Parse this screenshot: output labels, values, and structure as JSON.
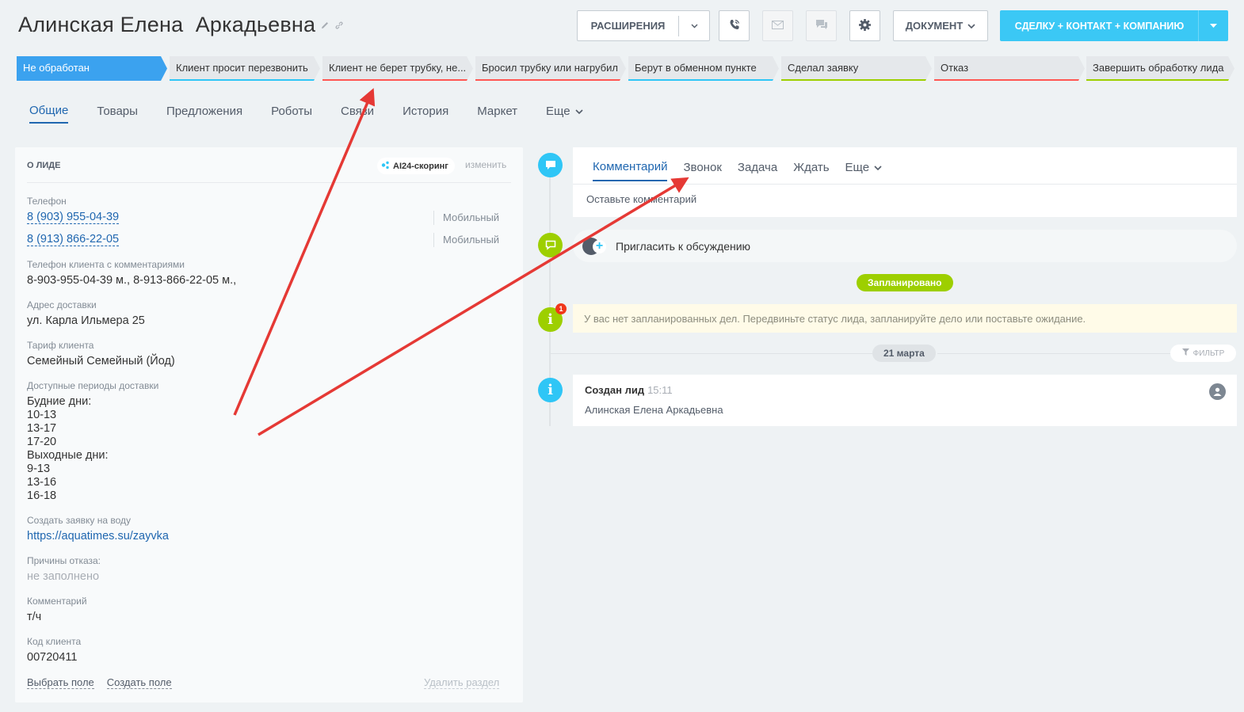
{
  "header": {
    "title": "Алинская Елена  Аркадьевна",
    "extensions_label": "РАСШИРЕНИЯ",
    "document_label": "ДОКУМЕНТ",
    "create_label": "СДЕЛКУ + КОНТАКТ + КОМПАНИЮ"
  },
  "stages": [
    {
      "label": "Не обработан",
      "color": "#3ba2ef",
      "active": true
    },
    {
      "label": "Клиент просит перезвонить",
      "color": "#2fc6f6"
    },
    {
      "label": "Клиент не берет трубку, не...",
      "color": "#ff5752"
    },
    {
      "label": "Бросил трубку или нагрубил",
      "color": "#ff5752"
    },
    {
      "label": "Берут в обменном пункте",
      "color": "#2fc6f6"
    },
    {
      "label": "Сделал заявку",
      "color": "#9dcf00"
    },
    {
      "label": "Отказ",
      "color": "#ff5752"
    },
    {
      "label": "Завершить обработку лида",
      "color": "#9dcf00"
    }
  ],
  "tabs": [
    {
      "label": "Общие",
      "active": true
    },
    {
      "label": "Товары"
    },
    {
      "label": "Предложения"
    },
    {
      "label": "Роботы"
    },
    {
      "label": "Связи"
    },
    {
      "label": "История"
    },
    {
      "label": "Маркет"
    },
    {
      "label": "Еще"
    }
  ],
  "card": {
    "heading": "О ЛИДЕ",
    "ai_label": "AI24-скоринг",
    "change_label": "изменить",
    "phone_label": "Телефон",
    "phones": [
      {
        "number": "8 (903) 955-04-39",
        "type": "Мобильный"
      },
      {
        "number": "8 (913) 866-22-05",
        "type": "Мобильный"
      }
    ],
    "phone_comments_label": "Телефон клиента с комментариями",
    "phone_comments_value": "8-903-955-04-39 м., 8-913-866-22-05 м.,",
    "address_label": "Адрес доставки",
    "address_value": "ул. Карла Ильмера 25",
    "tariff_label": "Тариф клиента",
    "tariff_value": "Семейный Семейный (Йод)",
    "periods_label": "Доступные периоды доставки",
    "periods_lines": [
      "Будние дни:",
      "10-13",
      "13-17",
      "17-20",
      "Выходные дни:",
      "9-13",
      "13-16",
      "16-18"
    ],
    "order_label": "Создать заявку на воду",
    "order_url": "https://aquatimes.su/zayvka",
    "refuse_label": "Причины отказа:",
    "refuse_value": "не заполнено",
    "comment_label": "Комментарий",
    "comment_value": "т/ч",
    "code_label": "Код клиента",
    "code_value": "00720411",
    "select_field": "Выбрать поле",
    "create_field": "Создать поле",
    "delete_section": "Удалить раздел"
  },
  "timeline": {
    "composer_tabs": [
      {
        "label": "Комментарий",
        "active": true
      },
      {
        "label": "Звонок"
      },
      {
        "label": "Задача"
      },
      {
        "label": "Ждать"
      },
      {
        "label": "Еще"
      }
    ],
    "placeholder": "Оставьте комментарий",
    "invite_label": "Пригласить к обсуждению",
    "planned_label": "Запланировано",
    "notice_badge": "1",
    "notice_text": "У вас нет запланированных дел. Передвиньте статус лида, запланируйте дело или поставьте ожидание.",
    "date_label": "21 марта",
    "filter_label": "ФИЛЬТР",
    "event_title": "Создан лид",
    "event_time": "15:11",
    "event_body": "Алинская Елена Аркадьевна"
  },
  "colors": {
    "accent": "#2067b0",
    "create_button": "#3bc8f5",
    "annotation_arrow": "#e53935"
  }
}
